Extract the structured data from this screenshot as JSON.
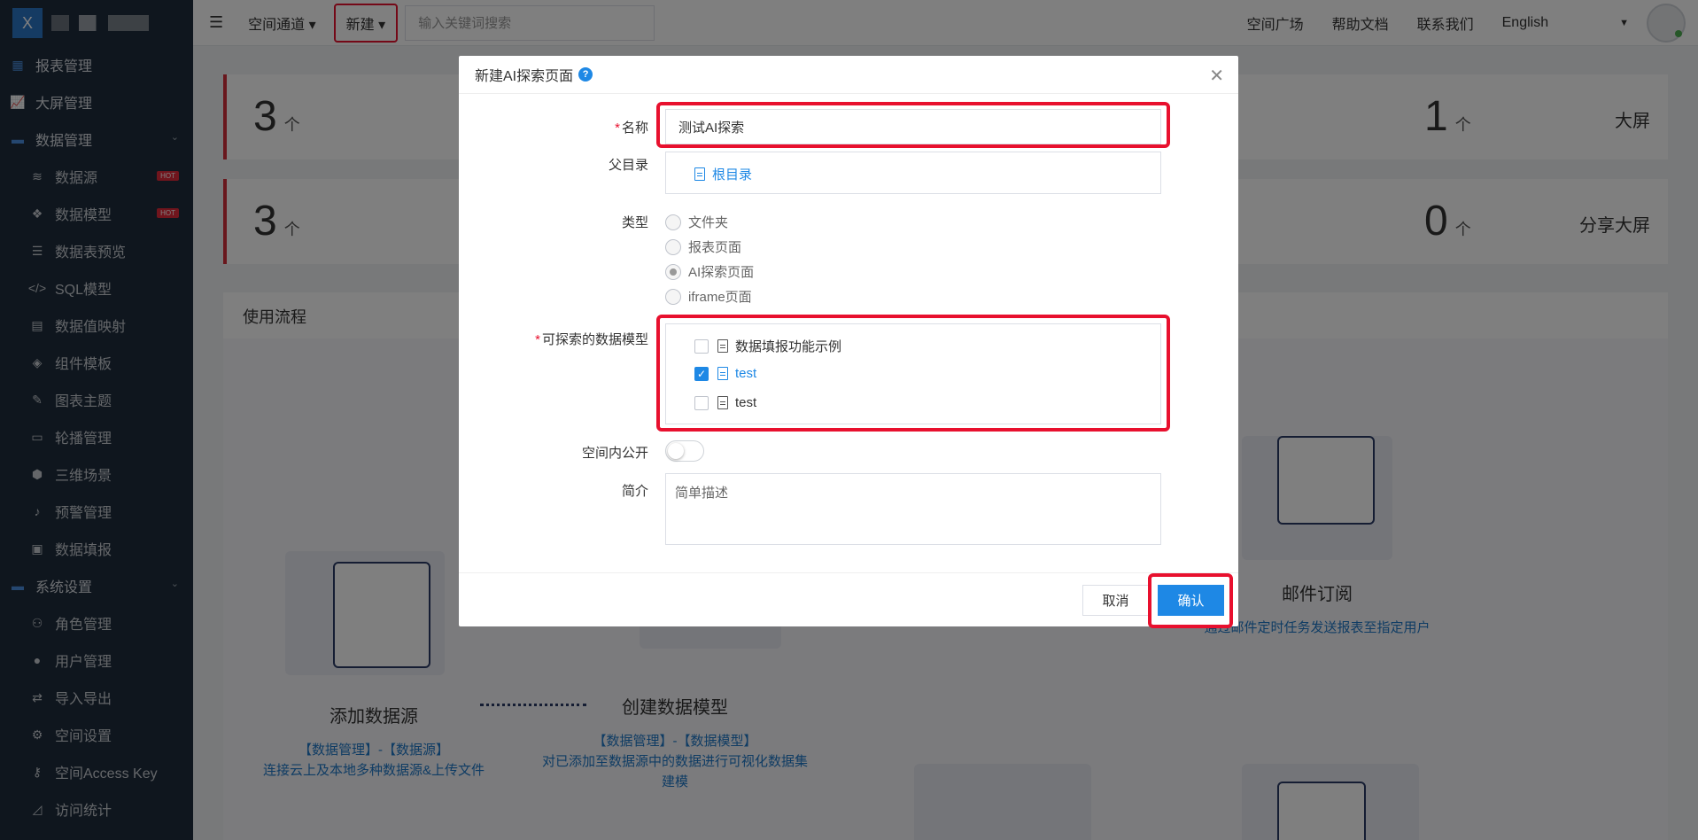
{
  "brand": {
    "logo_letter": "X"
  },
  "sidebar": {
    "items": [
      {
        "label": "报表管理",
        "icon": "grid-icon",
        "level": "top"
      },
      {
        "label": "大屏管理",
        "icon": "chart-line-icon",
        "level": "top"
      },
      {
        "label": "数据管理",
        "icon": "folder-icon",
        "level": "top",
        "expanded": true
      },
      {
        "label": "数据源",
        "icon": "database-icon",
        "level": "sub",
        "badge": "HOT"
      },
      {
        "label": "数据模型",
        "icon": "cubes-icon",
        "level": "sub",
        "badge": "HOT"
      },
      {
        "label": "数据表预览",
        "icon": "list-icon",
        "level": "sub"
      },
      {
        "label": "SQL模型",
        "icon": "code-icon",
        "level": "sub"
      },
      {
        "label": "数据值映射",
        "icon": "book-icon",
        "level": "sub"
      },
      {
        "label": "组件模板",
        "icon": "codepen-icon",
        "level": "sub"
      },
      {
        "label": "图表主题",
        "icon": "magic-icon",
        "level": "sub"
      },
      {
        "label": "轮播管理",
        "icon": "monitor-icon",
        "level": "sub"
      },
      {
        "label": "三维场景",
        "icon": "cube-icon",
        "level": "sub"
      },
      {
        "label": "预警管理",
        "icon": "bell-icon",
        "level": "sub"
      },
      {
        "label": "数据填报",
        "icon": "id-card-icon",
        "level": "sub"
      },
      {
        "label": "系统设置",
        "icon": "folder-icon",
        "level": "top",
        "expanded": true
      },
      {
        "label": "角色管理",
        "icon": "users-icon",
        "level": "sub"
      },
      {
        "label": "用户管理",
        "icon": "user-icon",
        "level": "sub"
      },
      {
        "label": "导入导出",
        "icon": "exchange-icon",
        "level": "sub"
      },
      {
        "label": "空间设置",
        "icon": "gear-icon",
        "level": "sub"
      },
      {
        "label": "空间Access Key",
        "icon": "key-icon",
        "level": "sub"
      },
      {
        "label": "访问统计",
        "icon": "chart-area-icon",
        "level": "sub"
      }
    ]
  },
  "header": {
    "channel": "空间通道",
    "new_button": "新建",
    "search_placeholder": "输入关键词搜索",
    "links": [
      "空间广场",
      "帮助文档",
      "联系我们",
      "English"
    ]
  },
  "stats": [
    {
      "value": "3",
      "unit": "个",
      "label": ""
    },
    {
      "value": "1",
      "unit": "个",
      "label": "大屏"
    },
    {
      "value": "3",
      "unit": "个",
      "label": ""
    },
    {
      "value": "0",
      "unit": "个",
      "label": "分享大屏"
    }
  ],
  "flow": {
    "title": "使用流程",
    "steps": [
      {
        "title": "添加数据源",
        "lines": [
          "【数据管理】-【数据源】",
          "连接云上及本地多种数据源&上传文件"
        ]
      },
      {
        "title": "创建数据模型",
        "lines": [
          "【数据管理】-【数据模型】",
          "对已添加至数据源中的数据进行可视化数据集",
          "建模"
        ]
      },
      {
        "title": "邮件订阅",
        "lines": [
          "通过邮件定时任务发送报表至指定用户"
        ]
      }
    ]
  },
  "dialog": {
    "title": "新建AI探索页面",
    "name_label": "名称",
    "name_value": "测试AI探索",
    "parent_label": "父目录",
    "parent_value": "根目录",
    "type_label": "类型",
    "type_options": [
      {
        "label": "文件夹",
        "selected": false
      },
      {
        "label": "报表页面",
        "selected": false
      },
      {
        "label": "AI探索页面",
        "selected": true
      },
      {
        "label": "iframe页面",
        "selected": false
      }
    ],
    "models_label": "可探索的数据模型",
    "models": [
      {
        "label": "数据填报功能示例",
        "checked": false
      },
      {
        "label": "test",
        "checked": true
      },
      {
        "label": "test",
        "checked": false
      }
    ],
    "public_label": "空间内公开",
    "public_on": false,
    "desc_label": "简介",
    "desc_placeholder": "简单描述",
    "cancel": "取消",
    "confirm": "确认"
  },
  "colors": {
    "accent": "#1e88e5",
    "highlight": "#e8102e",
    "sidebar_bg": "#1f2d3d"
  }
}
